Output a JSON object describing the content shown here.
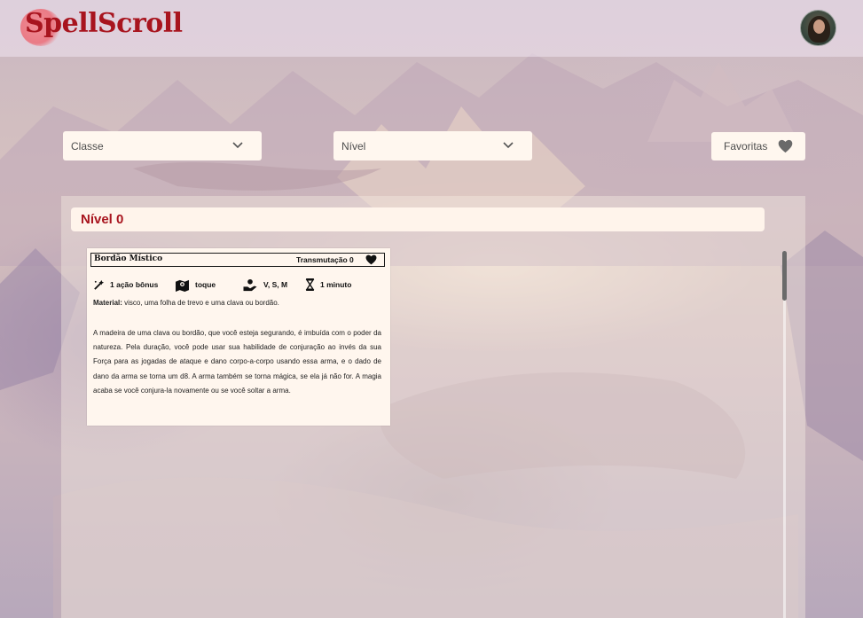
{
  "app": {
    "logo_text": "SpellScroll",
    "brand_color": "#a8141e"
  },
  "header": {
    "avatar_alt": "avatar"
  },
  "filters": {
    "class_select": {
      "value": "Classe",
      "icon": "chevron-down-icon"
    },
    "level_select": {
      "value": "Nível",
      "icon": "chevron-down-icon"
    },
    "favorites_button": {
      "label": "Favoritas",
      "icon": "heart-icon"
    }
  },
  "spell_list": {
    "level_heading": "Nível 0",
    "cards": [
      {
        "name": "Bordão Místico",
        "school": "Transmutação 0",
        "casting_time": "1 ação bônus",
        "range": "toque",
        "components": "V, S, M",
        "duration": "1 minuto",
        "material_label": "Material:",
        "material_text": "visco, uma folha de trevo e uma clava ou bordão.",
        "description": "A madeira de uma clava ou bordão, que você esteja segurando, é imbuída com o poder da natureza. Pela duração, você pode usar sua habilidade de conjuração ao invés da sua Força para as jogadas de ataque e dano corpo-a-corpo usando essa arma, e o dado de dano da arma se torna um d8. A arma também se torna mágica, se ela já não for. A magia acaba se você conjura-la novamente ou se você soltar a arma."
      }
    ]
  }
}
